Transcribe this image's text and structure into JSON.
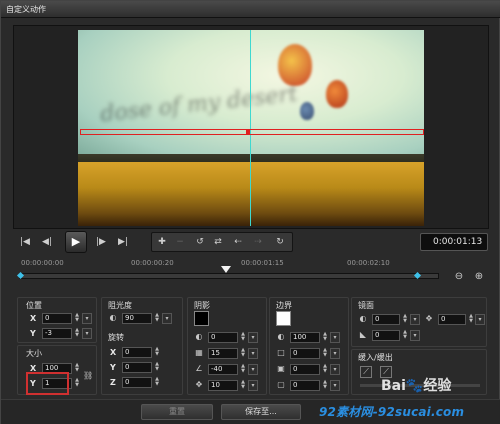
{
  "window": {
    "title": "自定义动作"
  },
  "preview": {
    "watermark_text": "dose of my desert"
  },
  "timecode": "0:00:01:13",
  "ruler": {
    "labels": [
      "00:00:00:00",
      "00:00:00:20",
      "00:00:01:15",
      "00:00:02:10"
    ]
  },
  "position": {
    "title": "位置",
    "x": "0",
    "y": "-3"
  },
  "size": {
    "title": "大小",
    "x": "100",
    "y": "1"
  },
  "opacity": {
    "title": "阻光度",
    "value": "90"
  },
  "rotation": {
    "title": "旋转",
    "x": "0",
    "y": "0",
    "z": "0"
  },
  "shadow": {
    "title": "阴影",
    "v1": "0",
    "v2": "15",
    "v3": "-40",
    "v4": "10"
  },
  "border": {
    "title": "边界",
    "v1": "100",
    "v2": "0",
    "v3": "0",
    "v4": "0"
  },
  "mirror": {
    "title": "镜面",
    "v1": "0",
    "v2": "0",
    "v3": "0"
  },
  "fade": {
    "title": "缓入/缓出"
  },
  "buttons": {
    "reset": "重置",
    "save": "保存至..."
  },
  "watermarks": {
    "baidu": "Bai",
    "baidu2": "经验",
    "site": "92素材网-92sucai.com"
  },
  "colors": {
    "accent_red": "#e02020",
    "guide_cyan": "#3ed8d0",
    "keyframe": "#3ec0e8"
  }
}
